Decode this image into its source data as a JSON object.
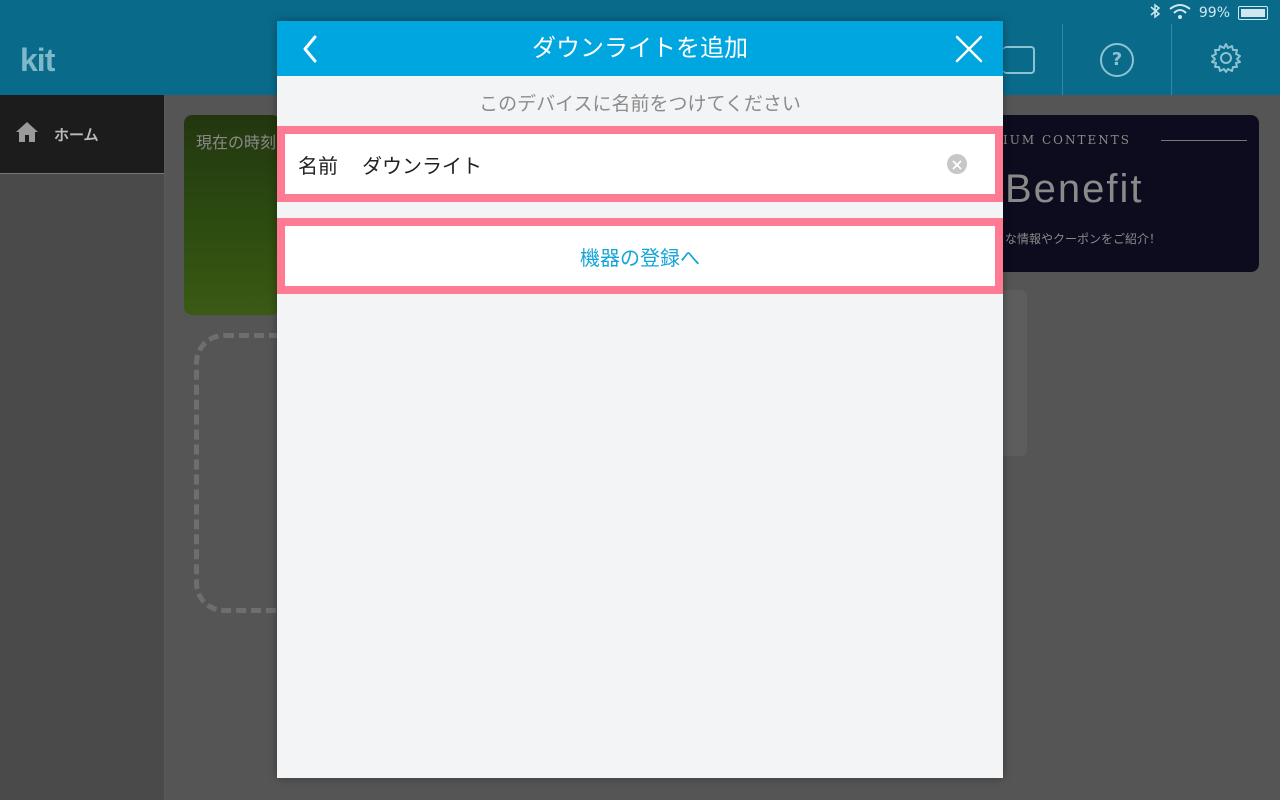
{
  "status": {
    "battery_text": "99%",
    "battery_level": 0.99
  },
  "app": {
    "logo": "kit"
  },
  "header": {
    "help_symbol": "?"
  },
  "sidebar": {
    "items": [
      {
        "label": "ホーム"
      }
    ]
  },
  "background_cards": {
    "time_card_label": "現在の時刻",
    "premium_header": "IUM CONTENTS",
    "premium_title": "Benefit",
    "premium_sub": "な情報やクーポンをご紹介！"
  },
  "modal": {
    "title": "ダウンライトを追加",
    "subtitle": "このデバイスに名前をつけてください",
    "name_label": "名前",
    "name_value": "ダウンライト",
    "register_label": "機器の登録へ"
  },
  "colors": {
    "accent": "#00a6e0",
    "highlight_frame": "#ff7a93",
    "link_text": "#14a4d8"
  }
}
